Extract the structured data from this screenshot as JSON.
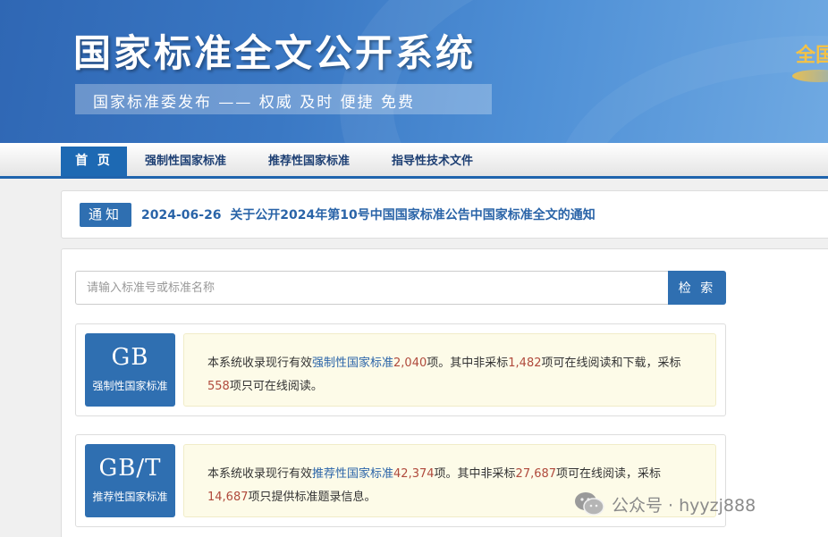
{
  "header": {
    "site_title": "国家标准全文公开系统",
    "slogan": "国家标准委发布  ——  权威  及时  便捷  免费",
    "corner_logo_text": "全国",
    "colors": {
      "banner_start": "#2f67b4",
      "banner_end": "#6fa9e2",
      "accent_gold": "#f4c246"
    }
  },
  "nav": {
    "items": [
      {
        "label": "首 页",
        "active": true
      },
      {
        "label": "强制性国家标准",
        "active": false
      },
      {
        "label": "推荐性国家标准",
        "active": false
      },
      {
        "label": "指导性技术文件",
        "active": false
      }
    ]
  },
  "notice": {
    "badge": "通知",
    "date": "2024-06-26",
    "title": "关于公开2024年第10号中国国家标准公告中国家标准全文的通知"
  },
  "search": {
    "placeholder": "请输入标准号或标准名称",
    "value": "",
    "button_label": "检 索"
  },
  "standards": [
    {
      "code": "GB",
      "name": "强制性国家标准",
      "desc_prefix": "本系统收录现行有效",
      "desc_link": "强制性国家标准",
      "total": "2,040",
      "desc_mid1": "项。其中非采标",
      "non_adopted": "1,482",
      "desc_mid2": "项可在线阅读和下载，采标",
      "adopted": "558",
      "desc_suffix": "项只可在线阅读。"
    },
    {
      "code": "GB/T",
      "name": "推荐性国家标准",
      "desc_prefix": "本系统收录现行有效",
      "desc_link": "推荐性国家标准",
      "total": "42,374",
      "desc_mid1": "项。其中非采标",
      "non_adopted": "27,687",
      "desc_mid2": "项可在线阅读，采标",
      "adopted": "14,687",
      "desc_suffix": "项只提供标准题录信息。"
    }
  ],
  "watermark": {
    "icon": "wechat-icon",
    "text": "公众号 · hyyzj888"
  },
  "theme": {
    "primary_blue": "#2f6fb1",
    "link_blue": "#2a64a8",
    "number_red": "#b04a3c",
    "desc_bg": "#fdfbe8"
  }
}
